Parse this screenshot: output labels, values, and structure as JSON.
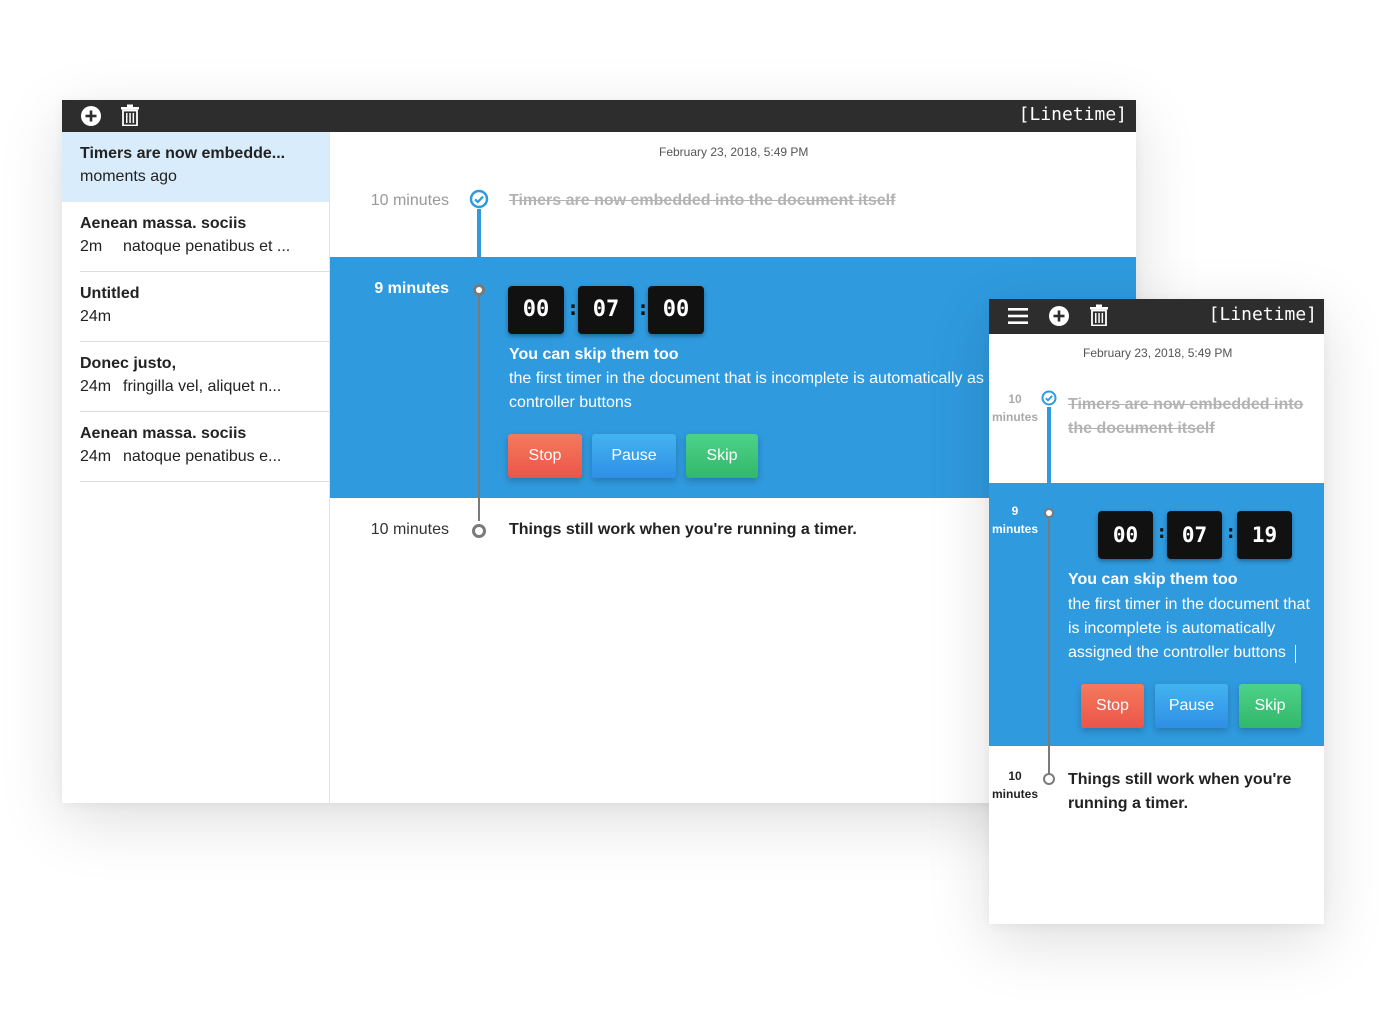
{
  "desktop": {
    "brand": "[Linetime]",
    "toolbar": {
      "add_icon": "plus-circle-icon",
      "delete_icon": "trash-icon"
    },
    "notes": [
      {
        "title": "Timers are now embedde...",
        "ago": "moments ago",
        "preview": ""
      },
      {
        "title": "Aenean massa. sociis",
        "ago": "2m",
        "preview": "natoque penatibus et ..."
      },
      {
        "title": "Untitled",
        "ago": "24m",
        "preview": ""
      },
      {
        "title": "Donec justo,",
        "ago": "24m",
        "preview": "fringilla vel, aliquet n..."
      },
      {
        "title": "Aenean massa. sociis",
        "ago": "24m",
        "preview": "natoque penatibus e..."
      }
    ],
    "doc": {
      "date": "February 23, 2018, 5:49 PM",
      "done": {
        "duration": "10 minutes",
        "title": "Timers are now embedded into the document itself"
      },
      "current": {
        "duration": "9 minutes",
        "timer": {
          "h": "00",
          "m": "07",
          "s": "00"
        },
        "title": "You can skip them too",
        "desc_line1": "the first timer in the document that is incomplete is automatically as",
        "desc_line2": "controller buttons",
        "buttons": {
          "stop": "Stop",
          "pause": "Pause",
          "skip": "Skip"
        }
      },
      "next": {
        "duration": "10 minutes",
        "title": "Things still work when you're running a timer."
      }
    }
  },
  "mobile": {
    "brand": "[Linetime]",
    "toolbar": {
      "menu_icon": "hamburger-menu-icon",
      "add_icon": "plus-circle-icon",
      "delete_icon": "trash-icon"
    },
    "doc": {
      "date": "February 23, 2018, 5:49 PM",
      "done": {
        "dur_num": "10",
        "dur_unit": "minutes",
        "title_line1": "Timers are now embedded into",
        "title_line2": "the document itself"
      },
      "current": {
        "dur_num": "9",
        "dur_unit": "minutes",
        "timer": {
          "h": "00",
          "m": "07",
          "s": "19"
        },
        "title": "You can skip them too",
        "desc_line1": "the first timer in the document that",
        "desc_line2": "is incomplete is automatically",
        "desc_line3": "assigned the controller buttons",
        "buttons": {
          "stop": "Stop",
          "pause": "Pause",
          "skip": "Skip"
        }
      },
      "next": {
        "dur_num": "10",
        "dur_unit": "minutes",
        "title_line1": "Things still work when you're",
        "title_line2": "running a timer."
      }
    }
  },
  "colors": {
    "accent": "#2f9ade",
    "titlebar": "#2d2d2d",
    "selected_note": "#d9ecfb",
    "stop": "#ef5e4e",
    "pause": "#3aa2ea",
    "skip": "#3cc275"
  }
}
